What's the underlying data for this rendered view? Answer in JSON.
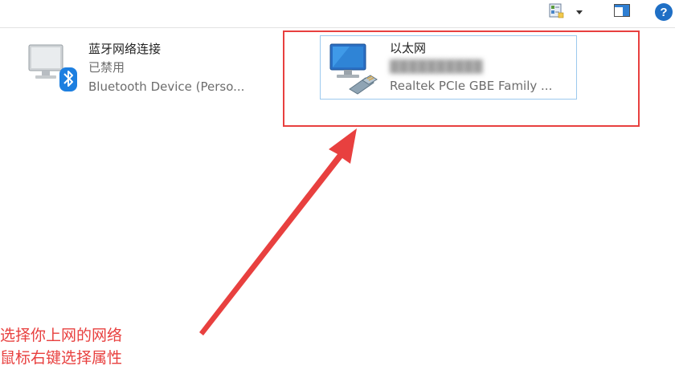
{
  "toolbar": {
    "view_icon": "change-view-icon",
    "dropdown_icon": "chevron-down-icon",
    "preview_pane_icon": "preview-pane-icon",
    "help_icon": "help-icon",
    "help_label": "?"
  },
  "adapters": [
    {
      "name": "蓝牙网络连接",
      "status": "已禁用",
      "device": "Bluetooth Device (Perso...",
      "icon": "bluetooth-adapter-icon",
      "selected": false
    },
    {
      "name": "以太网",
      "status": "",
      "device": "Realtek PCIe GBE Family ...",
      "icon": "ethernet-adapter-icon",
      "selected": true
    }
  ],
  "annotation": {
    "line1": "选择你上网的网络",
    "line2": "鼠标右键选择属性"
  },
  "colors": {
    "annotation": "#e8403f",
    "selection_border": "#9cc9ee",
    "help_blue": "#1f6fc5"
  }
}
